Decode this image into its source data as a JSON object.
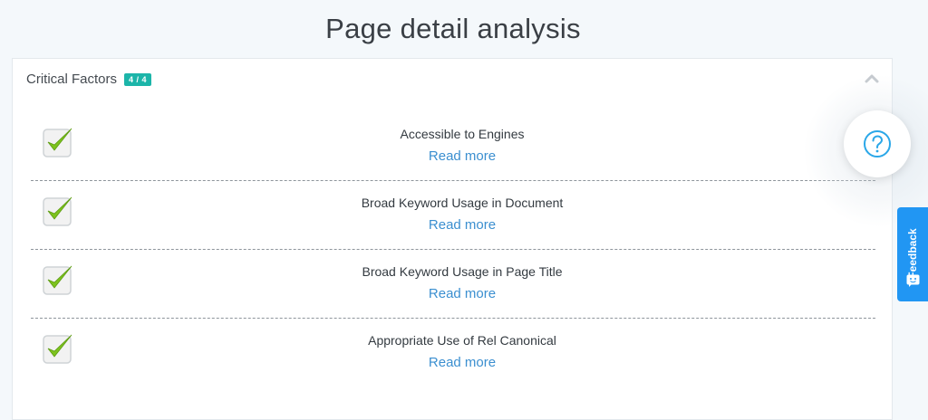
{
  "page": {
    "title": "Page detail analysis"
  },
  "panel": {
    "title": "Critical Factors",
    "badge": "4 / 4",
    "collapse_icon": "chevron-up-icon"
  },
  "factors": [
    {
      "name": "Accessible to Engines",
      "link": "Read more",
      "status": "passed",
      "icon": "checkmark-icon"
    },
    {
      "name": "Broad Keyword Usage in Document",
      "link": "Read more",
      "status": "passed",
      "icon": "checkmark-icon"
    },
    {
      "name": "Broad Keyword Usage in Page Title",
      "link": "Read more",
      "status": "passed",
      "icon": "checkmark-icon"
    },
    {
      "name": "Appropriate Use of Rel Canonical",
      "link": "Read more",
      "status": "passed",
      "icon": "checkmark-icon"
    }
  ],
  "help": {
    "icon": "question-icon"
  },
  "feedback": {
    "label": "Feedback",
    "icon": "smile-chat-icon"
  },
  "colors": {
    "background": "#f4f8fb",
    "badge": "#1cb5a9",
    "link": "#3b8fd0",
    "check": "#7dc31e",
    "feedback_tab": "#2196f3"
  }
}
